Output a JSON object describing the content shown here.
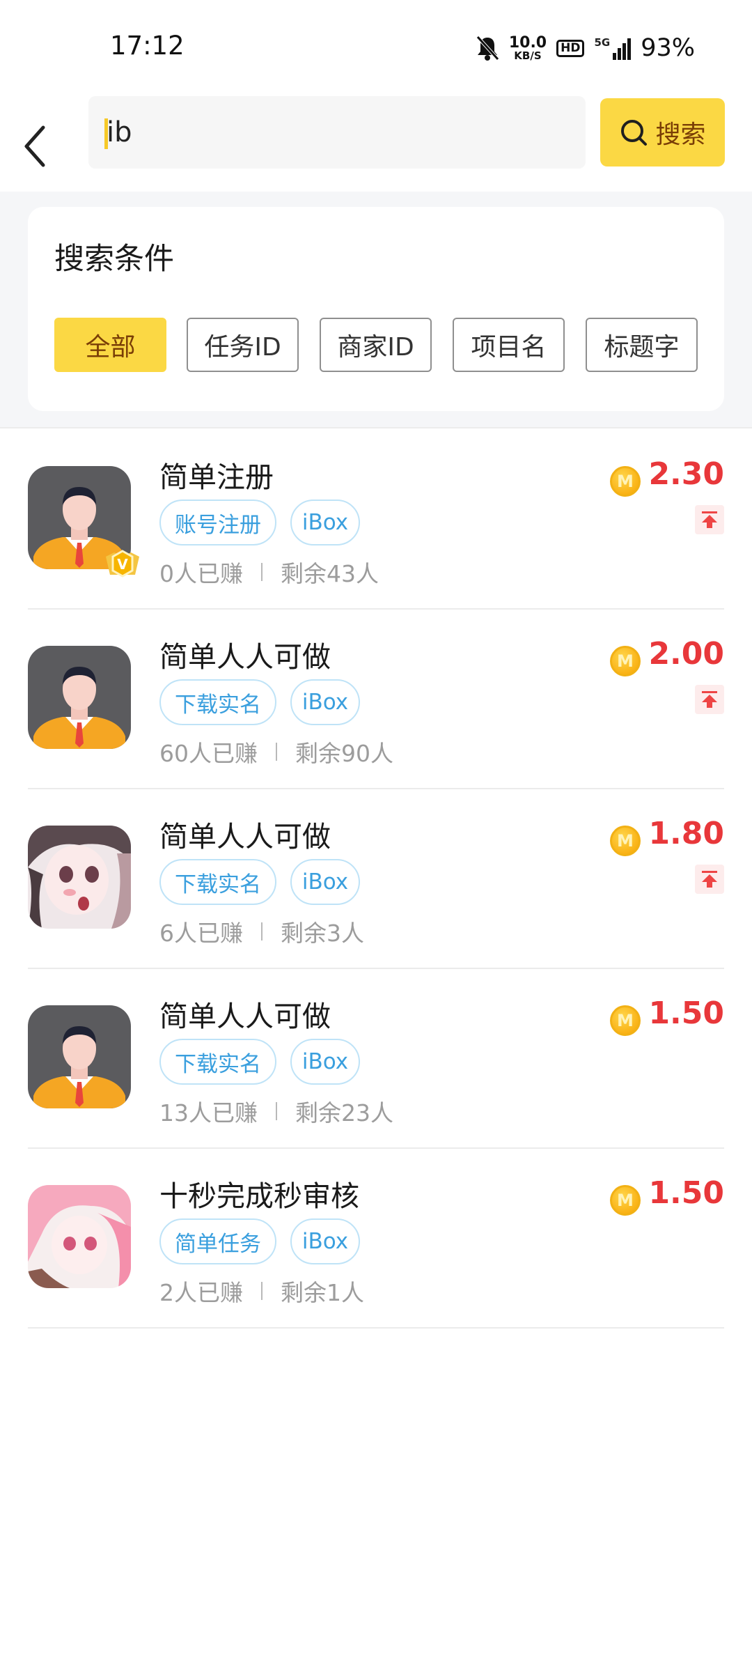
{
  "status_bar": {
    "time": "17:12",
    "net_speed_value": "10.0",
    "net_speed_unit": "KB/S",
    "hd_label": "HD",
    "network_type": "5G",
    "battery": "93%"
  },
  "header": {
    "search_value": "ib",
    "search_button_label": "搜索"
  },
  "filter": {
    "title": "搜索条件",
    "options": [
      {
        "label": "全部",
        "active": true
      },
      {
        "label": "任务ID",
        "active": false
      },
      {
        "label": "商家ID",
        "active": false
      },
      {
        "label": "项目名",
        "active": false
      },
      {
        "label": "标题字",
        "active": false
      }
    ]
  },
  "coin_glyph": "M",
  "tasks": [
    {
      "title": "简单注册",
      "tags": [
        "账号注册",
        "iBox"
      ],
      "earned": "0人已赚",
      "remaining": "剩余43人",
      "price": "2.30",
      "pinned": true,
      "avatar": "person-avatar",
      "vip": true,
      "vip_glyph": "V"
    },
    {
      "title": "简单人人可做",
      "tags": [
        "下载实名",
        "iBox"
      ],
      "earned": "60人已赚",
      "remaining": "剩余90人",
      "price": "2.00",
      "pinned": true,
      "avatar": "person-avatar",
      "vip": false
    },
    {
      "title": "简单人人可做",
      "tags": [
        "下载实名",
        "iBox"
      ],
      "earned": "6人已赚",
      "remaining": "剩余3人",
      "price": "1.80",
      "pinned": true,
      "avatar": "anime-avatar",
      "vip": false
    },
    {
      "title": "简单人人可做",
      "tags": [
        "下载实名",
        "iBox"
      ],
      "earned": "13人已赚",
      "remaining": "剩余23人",
      "price": "1.50",
      "pinned": false,
      "avatar": "person-avatar",
      "vip": false
    },
    {
      "title": "十秒完成秒审核",
      "tags": [
        "简单任务",
        "iBox"
      ],
      "earned": "2人已赚",
      "remaining": "剩余1人",
      "price": "1.50",
      "pinned": false,
      "avatar": "pink-anime-avatar",
      "vip": false
    }
  ]
}
